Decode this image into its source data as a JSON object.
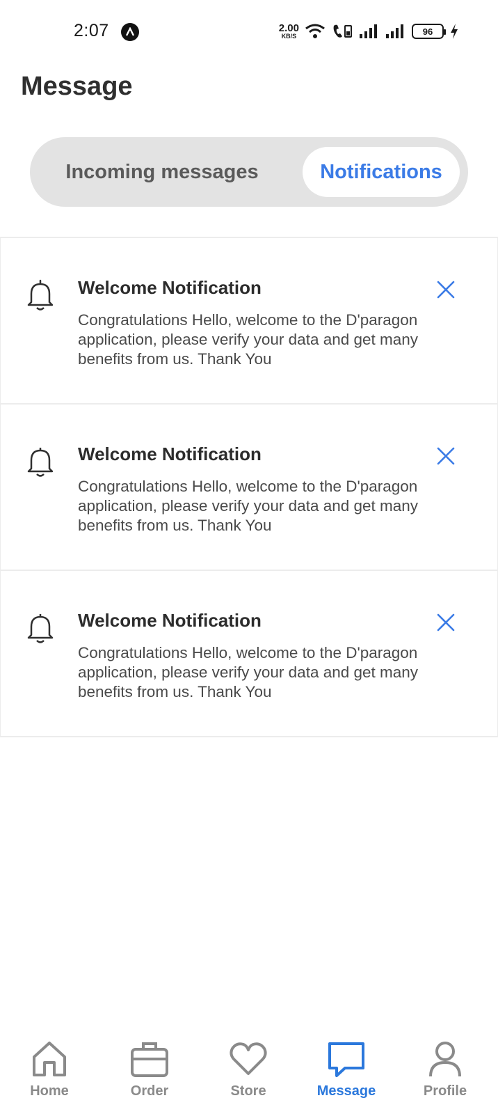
{
  "status_bar": {
    "time": "2:07",
    "net_speed_value": "2.00",
    "net_speed_unit": "KB/S",
    "battery_level": "96",
    "icons": [
      "app-notification-icon",
      "wifi-icon",
      "wifi-calling-icon",
      "signal-icon",
      "signal-icon",
      "battery-icon",
      "charging-icon"
    ]
  },
  "header": {
    "title": "Message"
  },
  "segmented": {
    "tabs": [
      {
        "label": "Incoming messages",
        "active": false
      },
      {
        "label": "Notifications",
        "active": true
      }
    ]
  },
  "notifications": [
    {
      "title": "Welcome Notification",
      "body": "Congratulations Hello, welcome to the D'paragon application, please verify your data and get many benefits from us. Thank You"
    },
    {
      "title": "Welcome Notification",
      "body": "Congratulations Hello, welcome to the D'paragon application, please verify your data and get many benefits from us. Thank You"
    },
    {
      "title": "Welcome Notification",
      "body": "Congratulations Hello, welcome to the D'paragon application, please verify your data and get many benefits from us. Thank You"
    }
  ],
  "bottom_nav": {
    "items": [
      {
        "label": "Home",
        "icon": "home-icon",
        "active": false
      },
      {
        "label": "Order",
        "icon": "briefcase-icon",
        "active": false
      },
      {
        "label": "Store",
        "icon": "heart-icon",
        "active": false
      },
      {
        "label": "Message",
        "icon": "chat-icon",
        "active": true
      },
      {
        "label": "Profile",
        "icon": "user-icon",
        "active": false
      }
    ]
  },
  "colors": {
    "accent": "#2b78dc",
    "tab_active_text": "#3b7be6",
    "segmented_bg": "#e3e3e3",
    "inactive_icon": "#8a8a8a"
  }
}
